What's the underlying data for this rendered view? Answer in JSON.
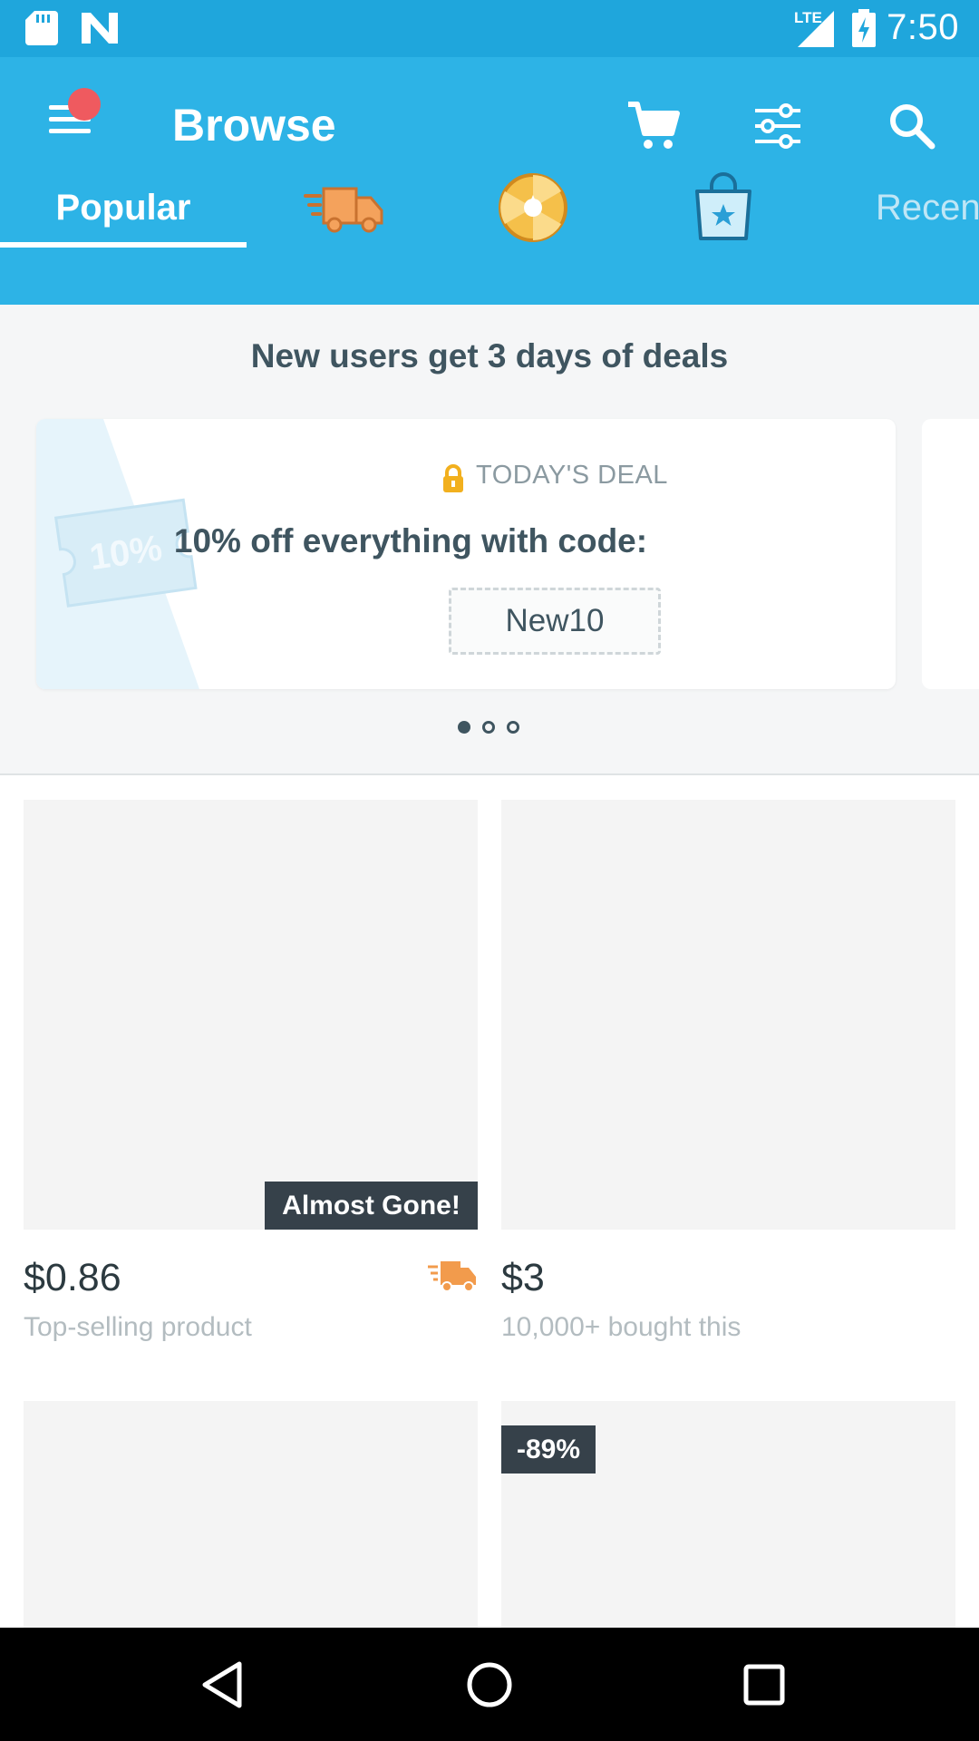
{
  "status_bar": {
    "time": "7:50",
    "network": "LTE"
  },
  "app_bar": {
    "menu_icon": "menu-icon",
    "notification_dot_color": "#ef5a5f",
    "title": "Browse",
    "cart_icon": "cart-icon",
    "filter_icon": "filter-icon",
    "search_icon": "search-icon"
  },
  "tabs": [
    {
      "label": "Popular",
      "active": true
    },
    {
      "icon": "express-truck-icon"
    },
    {
      "icon": "daily-wheel-icon"
    },
    {
      "icon": "star-bag-icon"
    },
    {
      "label": "Recen"
    }
  ],
  "promo": {
    "title": "New users get 3 days of deals",
    "deal_label": "TODAY'S DEAL",
    "deal_text": "10% off everything with code:",
    "code": "New10",
    "coupon_text": "10%",
    "page_count": 3,
    "active_page": 1
  },
  "products": [
    {
      "price": "$0.86",
      "subtitle": "Top-selling product",
      "badge": "Almost Gone!",
      "express_shipping": true
    },
    {
      "price": "$3",
      "subtitle": "10,000+ bought this"
    },
    {},
    {
      "discount_badge": "-89%"
    }
  ],
  "nav_bar": {
    "back_icon": "back-icon",
    "home_icon": "home-icon",
    "recents_icon": "recents-icon"
  }
}
